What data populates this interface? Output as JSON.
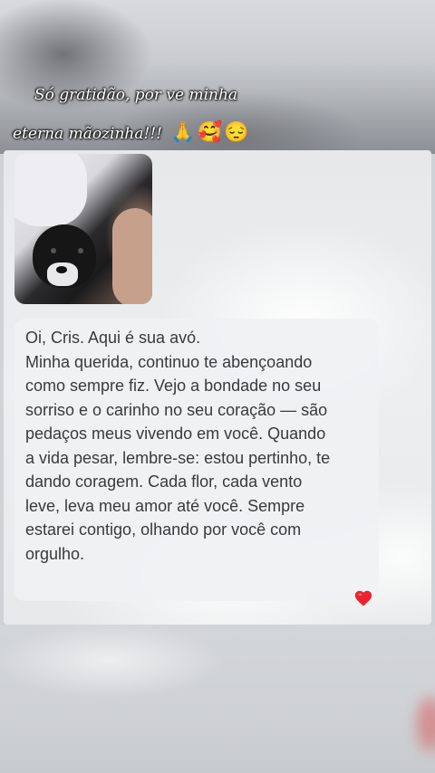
{
  "caption": {
    "line1": "Só gratidão, por ve minha",
    "line2": "eterna mãozinha!!!",
    "emojis": [
      "🙏",
      "🥰",
      "😔"
    ]
  },
  "card": {
    "message": "Oi, Cris. Aqui é sua avó.\nMinha querida, continuo te abençoando\ncomo sempre fiz. Vejo a bondade no seu\nsorriso e o carinho no seu coração — são\npedaços meus vivendo em você. Quando\na vida pesar, lembre-se: estou pertinho, te\ndando coragem. Cada flor, cada vento\nleve, leva meu amor até você. Sempre\nestarei contigo, olhando por você com\norgulho."
  },
  "icons": {
    "heart": "red-heart-icon",
    "photo": "dog-photo"
  },
  "colors": {
    "heart": "#e8252e",
    "text": "#3a3a3c"
  }
}
